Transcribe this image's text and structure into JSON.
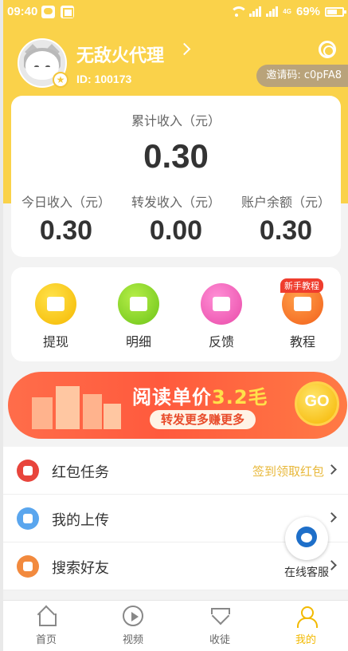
{
  "status_bar": {
    "time": "09:40",
    "network": "4G",
    "battery": "69%"
  },
  "profile": {
    "name": "无敌火代理",
    "id_text": "ID: 100173",
    "invite_code": "邀请码: c0pFA8"
  },
  "income": {
    "total_label": "累计收入（元）",
    "total_value": "0.30",
    "stats": [
      {
        "label": "今日收入（元）",
        "value": "0.30"
      },
      {
        "label": "转发收入（元）",
        "value": "0.00"
      },
      {
        "label": "账户余额（元）",
        "value": "0.30"
      }
    ]
  },
  "actions": [
    {
      "label": "提现",
      "icon": "wallet-icon"
    },
    {
      "label": "明细",
      "icon": "calendar-yen-icon"
    },
    {
      "label": "反馈",
      "icon": "message-icon"
    },
    {
      "label": "教程",
      "icon": "video-camera-icon"
    }
  ],
  "new_tag": "新手教程",
  "banner": {
    "title_part1": "阅读单价",
    "title_part2": "3.2毛",
    "subtitle": "转发更多赚更多",
    "go_label": "GO"
  },
  "list": [
    {
      "label": "红包任务",
      "hint": "签到领取红包",
      "icon": "red-envelope-icon"
    },
    {
      "label": "我的上传",
      "hint": "",
      "icon": "cloud-upload-icon"
    },
    {
      "label": "搜索好友",
      "hint": "",
      "icon": "person-icon"
    }
  ],
  "customer_service": "在线客服",
  "tabs": [
    {
      "label": "首页",
      "icon": "home-icon"
    },
    {
      "label": "视频",
      "icon": "play-icon"
    },
    {
      "label": "收徒",
      "icon": "diamond-icon"
    },
    {
      "label": "我的",
      "icon": "person-icon"
    }
  ],
  "colors": {
    "header": "#fad24a",
    "accent": "#f2b900",
    "hint": "#e8b83a"
  }
}
